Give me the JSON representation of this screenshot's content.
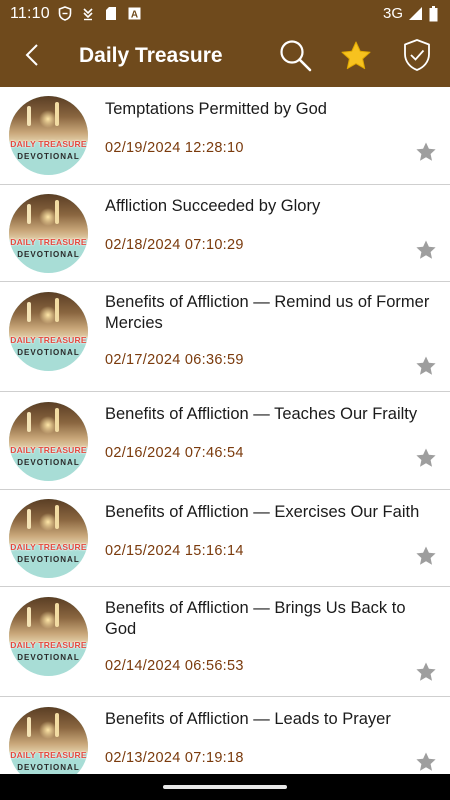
{
  "status_bar": {
    "time": "11:10",
    "network": "3G",
    "notification_icons": [
      "shield-outline-icon",
      "download-arrow-icon",
      "sd-card-icon",
      "text-a-icon"
    ]
  },
  "app_bar": {
    "title": "Daily Treasure",
    "background_color": "#6f4a1c",
    "back_icon": "chevron-left-icon",
    "search_icon": "search-icon",
    "favorites_icon": "star-filled-icon",
    "shield_icon": "shield-check-icon",
    "star_color": "#f7c21f"
  },
  "thumbnail": {
    "line1": "DAILY TREASURE",
    "line2": "DEVOTIONAL"
  },
  "items": [
    {
      "title": "Temptations Permitted by God",
      "date": "02/19/2024 12:28:10"
    },
    {
      "title": "Affliction Succeeded by Glory",
      "date": "02/18/2024 07:10:29"
    },
    {
      "title": "Benefits of Affliction — Remind us of Former Mercies",
      "date": "02/17/2024 06:36:59"
    },
    {
      "title": "Benefits of Affliction — Teaches Our Frailty",
      "date": "02/16/2024 07:46:54"
    },
    {
      "title": "Benefits of Affliction — Exercises Our Faith",
      "date": "02/15/2024 15:16:14"
    },
    {
      "title": "Benefits of Affliction — Brings Us Back to God",
      "date": "02/14/2024 06:56:53"
    },
    {
      "title": "Benefits of Affliction — Leads to Prayer",
      "date": "02/13/2024 07:19:18"
    }
  ],
  "colors": {
    "date_text": "#7a3a0c",
    "star_inactive": "#9e9e9e",
    "divider": "#cfcfcf"
  }
}
